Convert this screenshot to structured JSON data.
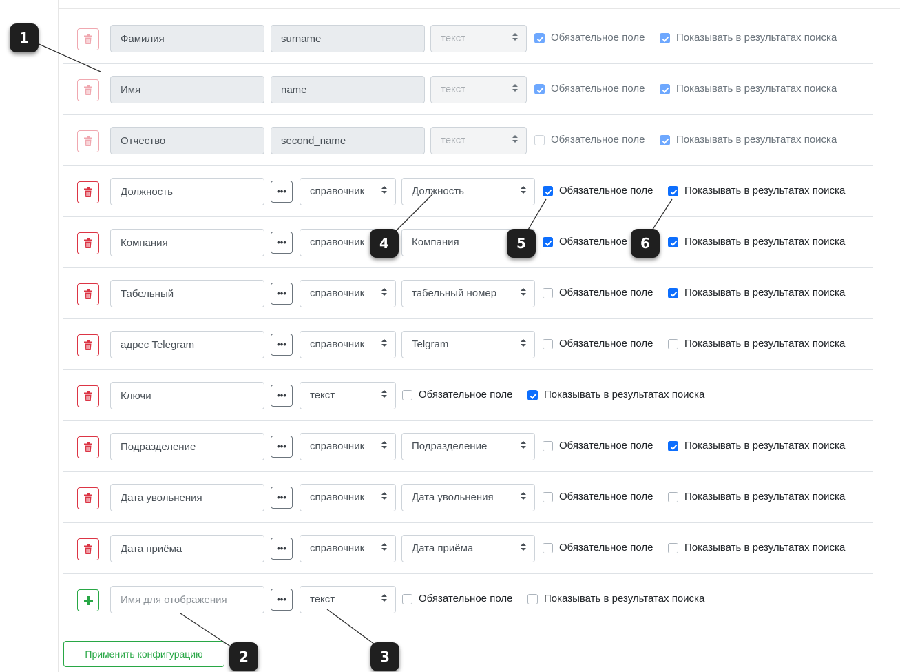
{
  "checkbox_labels": {
    "required": "Обязательное поле",
    "show_in_search": "Показывать в результатах поиска"
  },
  "rows": [
    {
      "name": "Фамилия",
      "code": "surname",
      "type": "текст",
      "required": true,
      "show_in_search": true
    },
    {
      "name": "Имя",
      "code": "name",
      "type": "текст",
      "required": true,
      "show_in_search": true
    },
    {
      "name": "Отчество",
      "code": "second_name",
      "type": "текст",
      "required": false,
      "show_in_search": true
    },
    {
      "name": "Должность",
      "type": "справочник",
      "reference": "Должность",
      "required": true,
      "show_in_search": true
    },
    {
      "name": "Компания",
      "type": "справочник",
      "reference": "Компания",
      "required": true,
      "show_in_search": true
    },
    {
      "name": "Табельный",
      "type": "справочник",
      "reference": "табельный номер",
      "required": false,
      "show_in_search": true
    },
    {
      "name": "адрес Telegram",
      "type": "справочник",
      "reference": "Telgram",
      "required": false,
      "show_in_search": false
    },
    {
      "name": "Ключи",
      "type": "текст",
      "required": false,
      "show_in_search": true
    },
    {
      "name": "Подразделение",
      "type": "справочник",
      "reference": "Подразделение",
      "required": false,
      "show_in_search": true
    },
    {
      "name": "Дата увольнения",
      "type": "справочник",
      "reference": "Дата увольнения",
      "required": false,
      "show_in_search": false
    },
    {
      "name": "Дата приёма",
      "type": "справочник",
      "reference": "Дата приёма",
      "required": false,
      "show_in_search": false
    }
  ],
  "new_row": {
    "name_placeholder": "Имя для отображения",
    "type": "текст",
    "required": false,
    "show_in_search": false
  },
  "dots_label": "•••",
  "apply_button": "Применить конфигурацию",
  "callouts": [
    "1",
    "2",
    "3",
    "4",
    "5",
    "6"
  ],
  "colors": {
    "primary": "#0d6efd",
    "danger": "#dc3545",
    "success": "#28a745"
  },
  "icons": {
    "delete": "trash-icon",
    "add": "plus-icon",
    "checkbox": "check-icon",
    "select": "sort-caret-icon"
  }
}
